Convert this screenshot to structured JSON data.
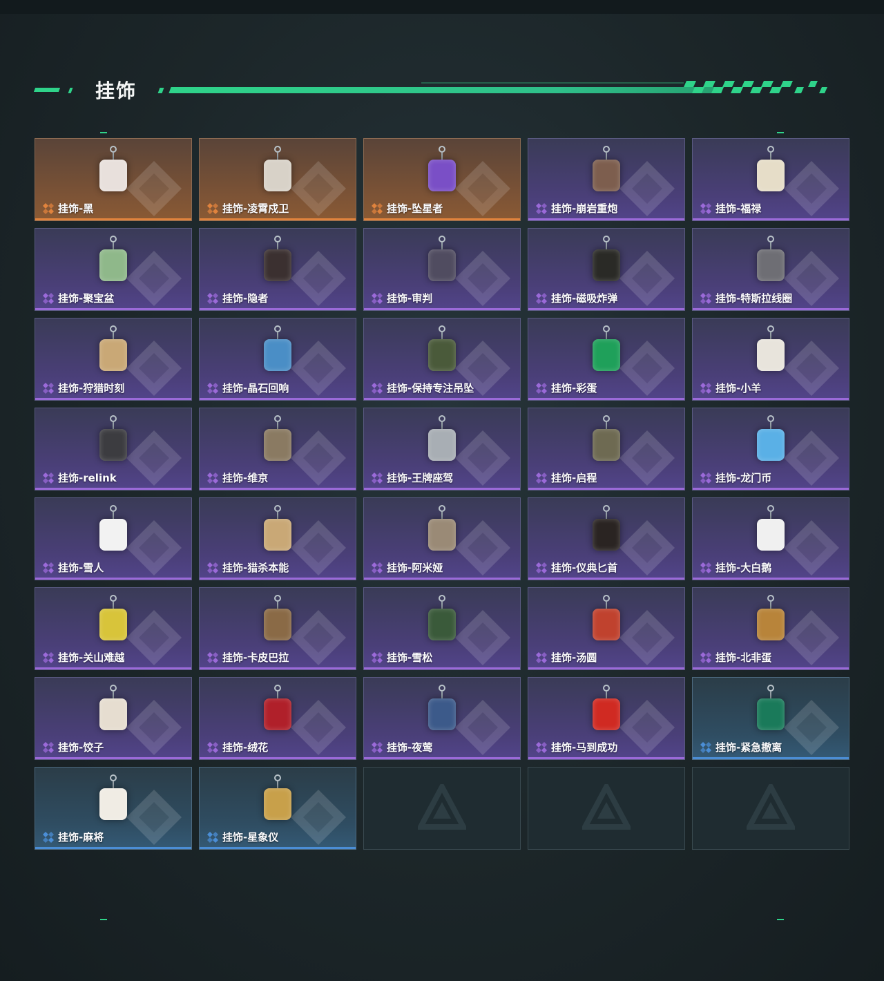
{
  "section": {
    "title": "挂饰"
  },
  "colors": {
    "accent": "#2fd38a",
    "rarity_orange": "#e0833d",
    "rarity_purple": "#9b6ad9",
    "rarity_blue": "#4b8ed6"
  },
  "items": [
    {
      "label": "挂饰-黑",
      "rarity": "orange",
      "icon": "charm-tag-icon",
      "charm_color": "#e8e0dc"
    },
    {
      "label": "挂饰-凌霄戍卫",
      "rarity": "orange",
      "icon": "charm-bird-icon",
      "charm_color": "#d8d2c8"
    },
    {
      "label": "挂饰-坠星者",
      "rarity": "orange",
      "icon": "charm-crystal-icon",
      "charm_color": "#7a4fc6"
    },
    {
      "label": "挂饰-崩岩重炮",
      "rarity": "purple",
      "icon": "charm-figure-icon",
      "charm_color": "#7d5e4e"
    },
    {
      "label": "挂饰-福禄",
      "rarity": "purple",
      "icon": "charm-gourd-icon",
      "charm_color": "#e6ddc8"
    },
    {
      "label": "挂饰-聚宝盆",
      "rarity": "purple",
      "icon": "charm-bowl-icon",
      "charm_color": "#8fb88a"
    },
    {
      "label": "挂饰-隐者",
      "rarity": "purple",
      "icon": "charm-card-icon",
      "charm_color": "#3b3030"
    },
    {
      "label": "挂饰-审判",
      "rarity": "purple",
      "icon": "charm-card-icon",
      "charm_color": "#504c60"
    },
    {
      "label": "挂饰-磁吸炸弹",
      "rarity": "purple",
      "icon": "charm-bomb-icon",
      "charm_color": "#2a2a26"
    },
    {
      "label": "挂饰-特斯拉线圈",
      "rarity": "purple",
      "icon": "charm-coil-icon",
      "charm_color": "#6e6e74"
    },
    {
      "label": "挂饰-狩猎时刻",
      "rarity": "purple",
      "icon": "charm-antlers-icon",
      "charm_color": "#c9a876"
    },
    {
      "label": "挂饰-晶石回响",
      "rarity": "purple",
      "icon": "charm-gem-icon",
      "charm_color": "#4a8ec6"
    },
    {
      "label": "挂饰-保持专注吊坠",
      "rarity": "purple",
      "icon": "charm-plate-icon",
      "charm_color": "#4a5a3a"
    },
    {
      "label": "挂饰-彩蛋",
      "rarity": "purple",
      "icon": "charm-egg-icon",
      "charm_color": "#1fa05a"
    },
    {
      "label": "挂饰-小羊",
      "rarity": "purple",
      "icon": "charm-sheep-icon",
      "charm_color": "#e8e4dc"
    },
    {
      "label": "挂饰-relink",
      "rarity": "purple",
      "icon": "charm-badge-icon",
      "charm_color": "#3c3c40"
    },
    {
      "label": "挂饰-维京",
      "rarity": "purple",
      "icon": "charm-hammer-icon",
      "charm_color": "#8a7a62"
    },
    {
      "label": "挂饰-王牌座驾",
      "rarity": "purple",
      "icon": "charm-jet-icon",
      "charm_color": "#a8aeb4"
    },
    {
      "label": "挂饰-启程",
      "rarity": "purple",
      "icon": "charm-medal-icon",
      "charm_color": "#6e6a52"
    },
    {
      "label": "挂饰-龙门币",
      "rarity": "purple",
      "icon": "charm-crystal-card-icon",
      "charm_color": "#5ab0e6"
    },
    {
      "label": "挂饰-雪人",
      "rarity": "purple",
      "icon": "charm-snowman-icon",
      "charm_color": "#f2f2f2"
    },
    {
      "label": "挂饰-猎杀本能",
      "rarity": "purple",
      "icon": "charm-antlers-icon",
      "charm_color": "#c9a876"
    },
    {
      "label": "挂饰-阿米娅",
      "rarity": "purple",
      "icon": "charm-rabbit-icon",
      "charm_color": "#9a8a76"
    },
    {
      "label": "挂饰-仪典匕首",
      "rarity": "purple",
      "icon": "charm-dagger-icon",
      "charm_color": "#2a2422"
    },
    {
      "label": "挂饰-大白鹅",
      "rarity": "purple",
      "icon": "charm-goose-icon",
      "charm_color": "#f0f0f0"
    },
    {
      "label": "挂饰-关山难越",
      "rarity": "purple",
      "icon": "charm-scroll-icon",
      "charm_color": "#d8c43a"
    },
    {
      "label": "挂饰-卡皮巴拉",
      "rarity": "purple",
      "icon": "charm-capybara-icon",
      "charm_color": "#8a6a46"
    },
    {
      "label": "挂饰-雪松",
      "rarity": "purple",
      "icon": "charm-tree-icon",
      "charm_color": "#3a5a3a"
    },
    {
      "label": "挂饰-汤圆",
      "rarity": "purple",
      "icon": "charm-bowl-icon",
      "charm_color": "#c0422e"
    },
    {
      "label": "挂饰-北非蛋",
      "rarity": "purple",
      "icon": "charm-pan-icon",
      "charm_color": "#b8843a"
    },
    {
      "label": "挂饰-饺子",
      "rarity": "purple",
      "icon": "charm-plate-icon",
      "charm_color": "#e6ddd0"
    },
    {
      "label": "挂饰-绒花",
      "rarity": "purple",
      "icon": "charm-flower-icon",
      "charm_color": "#b0202a"
    },
    {
      "label": "挂饰-夜莺",
      "rarity": "purple",
      "icon": "charm-feather-icon",
      "charm_color": "#3c5a8a"
    },
    {
      "label": "挂饰-马到成功",
      "rarity": "purple",
      "icon": "charm-horse-icon",
      "charm_color": "#d02a22"
    },
    {
      "label": "挂饰-紧急撤离",
      "rarity": "blue",
      "icon": "charm-skull-box-icon",
      "charm_color": "#1a7a5a"
    },
    {
      "label": "挂饰-麻将",
      "rarity": "blue",
      "icon": "charm-mahjong-icon",
      "charm_color": "#f0ece4"
    },
    {
      "label": "挂饰-星象仪",
      "rarity": "blue",
      "icon": "charm-astrolabe-icon",
      "charm_color": "#c8a04a"
    }
  ],
  "empty_slots": 3,
  "empty_icon": "delta-logo-icon"
}
